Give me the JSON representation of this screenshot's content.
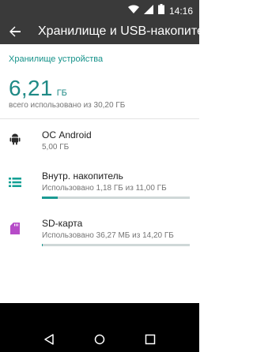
{
  "status_bar": {
    "time": "14:16"
  },
  "toolbar": {
    "title": "Хранилище и USB-накопители"
  },
  "device_storage": {
    "header": "Хранилище устройства",
    "total_used_number": "6,21",
    "total_used_unit": "ГБ",
    "total_summary": "всего использовано из 30,20 ГБ"
  },
  "items": [
    {
      "title": "ОС Android",
      "subtitle": "5,00 ГБ",
      "icon": "android-icon"
    },
    {
      "title": "Внутр. накопитель",
      "subtitle": "Использовано 1,18 ГБ из 11,00 ГБ",
      "icon": "storage-list-icon",
      "progress": 0.107
    },
    {
      "title": "SD-карта",
      "subtitle": "Использовано 36,27 МБ из 14,20 ГБ",
      "icon": "sd-card-icon",
      "progress": 0.0025
    }
  ],
  "colors": {
    "accent": "#15928a",
    "sd_icon": "#b64bc8",
    "bar": "#3a3a3a"
  }
}
